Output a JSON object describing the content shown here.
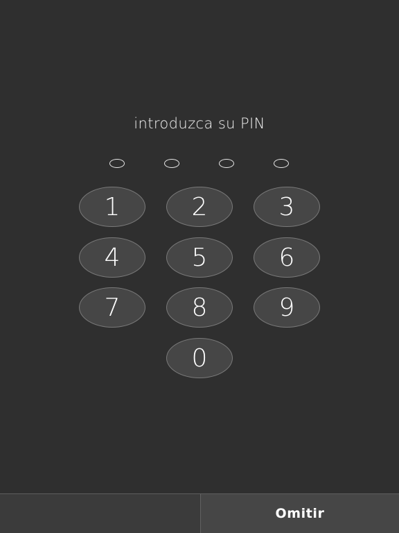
{
  "prompt": "introduzca su PIN",
  "pin": {
    "length": 4,
    "entered": 0
  },
  "keypad": {
    "keys": [
      "1",
      "2",
      "3",
      "4",
      "5",
      "6",
      "7",
      "8",
      "9",
      "0"
    ]
  },
  "bottom_bar": {
    "skip_label": "Omitir"
  },
  "colors": {
    "background": "#2f2f2f",
    "key_fill": "#464646",
    "key_border": "#7a7a7a",
    "text": "#ffffff"
  }
}
